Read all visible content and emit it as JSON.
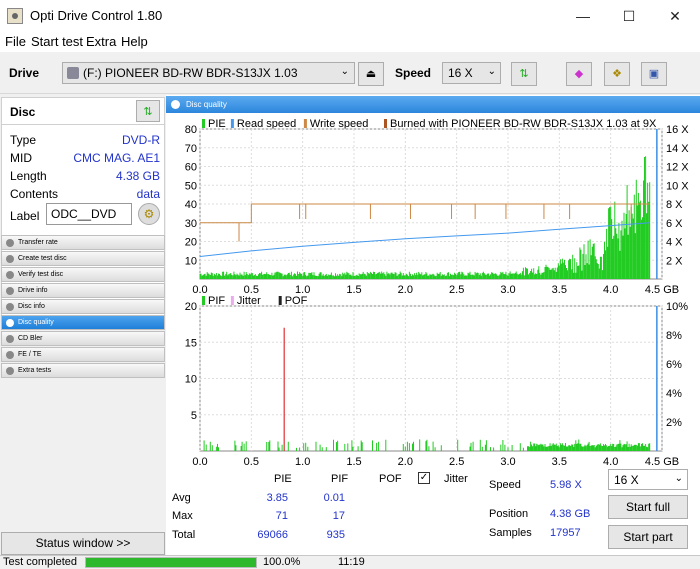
{
  "window": {
    "title": "Opti Drive Control 1.80",
    "minimize": "—",
    "maximize": "☐",
    "close": "✕"
  },
  "menu": [
    "File",
    "Start test",
    "Extra",
    "Help"
  ],
  "drivebar": {
    "drive_label": "Drive",
    "drive_value": "(F:)   PIONEER BD-RW   BDR-S13JX 1.03",
    "speed_label": "Speed",
    "speed_value": "16 X"
  },
  "disc": {
    "header": "Disc",
    "rows": [
      {
        "key": "Type",
        "value": "DVD-R"
      },
      {
        "key": "MID",
        "value": "CMC MAG. AE1"
      },
      {
        "key": "Length",
        "value": "4.38 GB"
      },
      {
        "key": "Contents",
        "value": "data"
      }
    ],
    "label_key": "Label",
    "label_value": "ODC__DVD"
  },
  "nav": [
    {
      "label": "Transfer rate",
      "active": false
    },
    {
      "label": "Create test disc",
      "active": false
    },
    {
      "label": "Verify test disc",
      "active": false
    },
    {
      "label": "Drive info",
      "active": false
    },
    {
      "label": "Disc info",
      "active": false
    },
    {
      "label": "Disc quality",
      "active": true
    },
    {
      "label": "CD Bler",
      "active": false
    },
    {
      "label": "FE / TE",
      "active": false
    },
    {
      "label": "Extra tests",
      "active": false
    }
  ],
  "status_window_button": "Status window >>",
  "panel_title": "Disc quality",
  "chart_data": [
    {
      "type": "line",
      "legend": [
        "PIE",
        "Read speed",
        "Write speed",
        "Burned with PIONEER BD-RW  BDR-S13JX 1.03 at 9X"
      ],
      "colors": {
        "PIE": "#22cc22",
        "Read speed": "#4499ee",
        "Write speed": "#cc8844",
        "burned": "#aa5522"
      },
      "xlim": [
        0,
        4.5
      ],
      "ylim": [
        0,
        80
      ],
      "x_ticks": [
        "0.0",
        "0.5",
        "1.0",
        "1.5",
        "2.0",
        "2.5",
        "3.0",
        "3.5",
        "4.0",
        "4.5 GB"
      ],
      "y_ticks": [
        "10",
        "20",
        "30",
        "40",
        "50",
        "60",
        "70",
        "80"
      ],
      "y2_ticks": [
        "2 X",
        "4 X",
        "6 X",
        "8 X",
        "10 X",
        "12 X",
        "14 X",
        "16 X"
      ],
      "read_speed": {
        "x": [
          0,
          0.5,
          1.0,
          1.5,
          2.0,
          2.5,
          3.0,
          3.5,
          4.0,
          4.38
        ],
        "y": [
          2.4,
          3.0,
          3.5,
          3.9,
          4.3,
          4.6,
          4.9,
          5.3,
          5.7,
          6.0
        ]
      },
      "write_speed_level": 8
    },
    {
      "type": "line",
      "legend": [
        "PIF",
        "Jitter",
        "POF"
      ],
      "colors": {
        "PIF": "#22cc22",
        "Jitter": "#eeaaee",
        "POF": "#222222"
      },
      "xlim": [
        0,
        4.5
      ],
      "ylim": [
        0,
        20
      ],
      "x_ticks": [
        "0.0",
        "0.5",
        "1.0",
        "1.5",
        "2.0",
        "2.5",
        "3.0",
        "3.5",
        "4.0",
        "4.5 GB"
      ],
      "y_ticks": [
        "5",
        "10",
        "15",
        "20"
      ],
      "y2_ticks": [
        "2%",
        "4%",
        "6%",
        "8%",
        "10%"
      ],
      "peak": {
        "x": 0.82,
        "y": 17
      }
    }
  ],
  "stats": {
    "headers": {
      "pie": "PIE",
      "pif": "PIF",
      "pof": "POF",
      "jitter": "Jitter"
    },
    "avg": {
      "label": "Avg",
      "pie": "3.85",
      "pif": "0.01"
    },
    "max": {
      "label": "Max",
      "pie": "71",
      "pif": "17"
    },
    "total": {
      "label": "Total",
      "pie": "69066",
      "pif": "935"
    },
    "speed_label": "Speed",
    "speed_value": "5.98 X",
    "position_label": "Position",
    "position_value": "4.38 GB",
    "samples_label": "Samples",
    "samples_value": "17957",
    "speed_select": "16 X",
    "start_full": "Start full",
    "start_part": "Start part"
  },
  "statusbar": {
    "text": "Test completed",
    "progress": 1.0,
    "percent": "100.0%",
    "time": "11:19"
  }
}
